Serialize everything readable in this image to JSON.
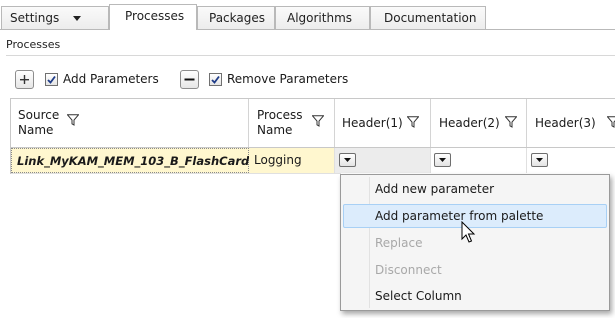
{
  "tabs": {
    "settings": "Settings",
    "processes": "Processes",
    "packages": "Packages",
    "algorithms": "Algorithms",
    "documentation": "Documentation"
  },
  "section_title": "Processes",
  "toolbar": {
    "add_parameters": "Add Parameters",
    "remove_parameters": "Remove Parameters",
    "add_checked": true,
    "remove_checked": true
  },
  "grid": {
    "columns": {
      "source_name_line1": "Source",
      "source_name_line2": "Name",
      "process_name_line1": "Process",
      "process_name_line2": "Name",
      "header1": "Header(1)",
      "header2": "Header(2)",
      "header3": "Header(3)"
    },
    "row": {
      "source_name": "Link_MyKAM_MEM_103_B_FlashCard",
      "process_name": "Logging"
    }
  },
  "context_menu": {
    "add_new_parameter": "Add new parameter",
    "add_parameter_from_palette": "Add parameter from palette",
    "replace": "Replace",
    "disconnect": "Disconnect",
    "select_column": "Select Column"
  },
  "colors": {
    "selected_cell": "#fff7cf",
    "menu_highlight": "#dcecfc",
    "menu_highlight_border": "#a8d0f5"
  }
}
